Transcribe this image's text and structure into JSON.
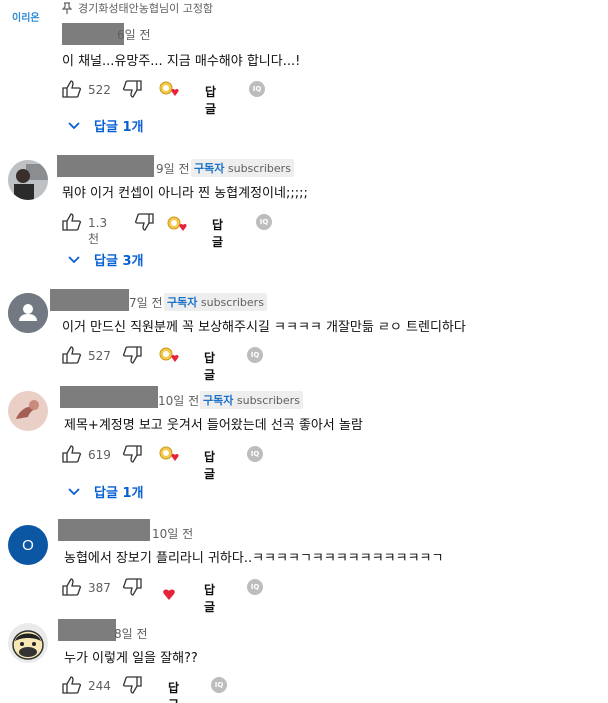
{
  "pinned": {
    "text": "경기화성태안농협님이 고정함"
  },
  "channel_logo": {
    "text": "이리온"
  },
  "comments": [
    {
      "time": "6일 전",
      "text": "이 채널...유망주... 지금 매수해야 합니다...!",
      "likes": "522",
      "reply_label": "답글",
      "replies_label": "답글 1개"
    },
    {
      "time": "9일 전",
      "badge_sub": "구독자",
      "badge_text": "subscribers",
      "text": "뭐야 이거 컨셉이 아니라 찐 농협계정이네;;;;;",
      "likes": "1.3천",
      "reply_label": "답글",
      "replies_label": "답글 3개"
    },
    {
      "time": "7일 전",
      "badge_sub": "구독자",
      "badge_text": "subscribers",
      "text": "이거 만드신 직원분께 꼭 보상해주시길 ㅋㅋㅋㅋ 개잘만듦 ㄹㅇ 트렌디하다",
      "likes": "527",
      "reply_label": "답글"
    },
    {
      "time": "10일 전",
      "badge_sub": "구독자",
      "badge_text": "subscribers",
      "text": "제목+계정명 보고 웃겨서 들어왔는데 선곡 좋아서 놀람",
      "likes": "619",
      "reply_label": "답글",
      "replies_label": "답글 1개"
    },
    {
      "avatar_letter": "O",
      "time": "10일 전",
      "text": "농협에서 장보기 플리라니 귀하다..ㅋㅋㅋㅋㄱㅋㅋㅋㅋㅋㅋㅋㅋㅋㅋㄱ",
      "likes": "387",
      "reply_label": "답글"
    },
    {
      "time": "8일 전",
      "text": "누가 이렇게 일을 잘해??",
      "likes": "244",
      "reply_label": "답글"
    }
  ],
  "icons": {
    "creator_mini": "IQ"
  },
  "colors": {
    "link": "#065fd4",
    "heart": "#e5243b",
    "badge_sub": "#1a73c9"
  }
}
